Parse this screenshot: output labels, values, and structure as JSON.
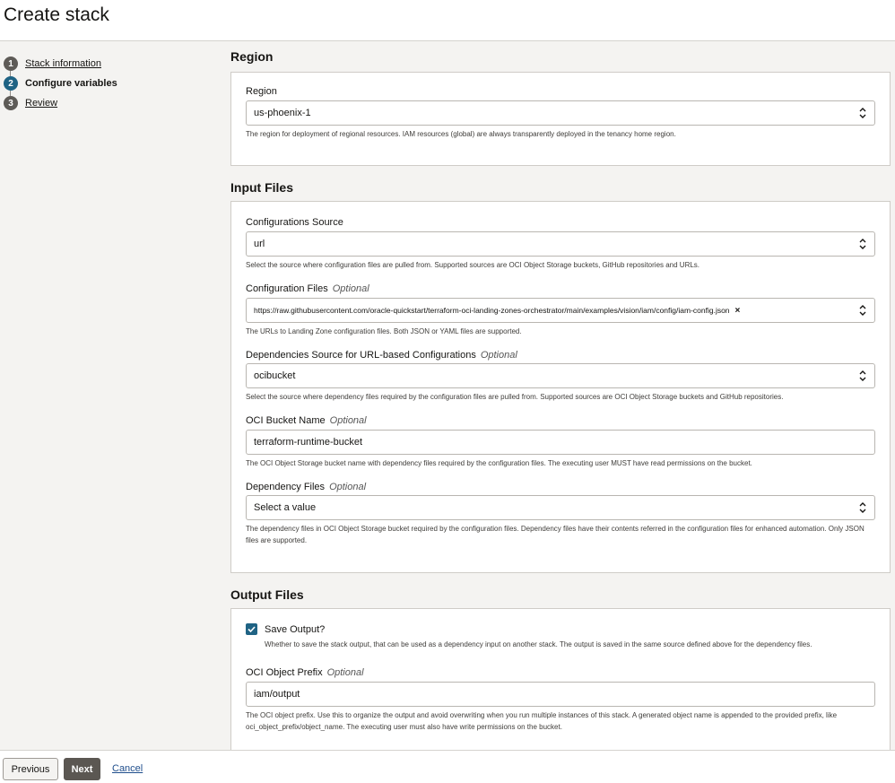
{
  "page": {
    "title": "Create stack"
  },
  "steps": [
    {
      "num": "1",
      "label": "Stack information"
    },
    {
      "num": "2",
      "label": "Configure variables"
    },
    {
      "num": "3",
      "label": "Review"
    }
  ],
  "region_section": {
    "title": "Region",
    "region_label": "Region",
    "region_value": "us-phoenix-1",
    "region_hint": "The region for deployment of regional resources. IAM resources (global) are always transparently deployed in the tenancy home region."
  },
  "input_section": {
    "title": "Input Files",
    "config_source_label": "Configurations Source",
    "config_source_value": "url",
    "config_source_hint": "Select the source where configuration files are pulled from. Supported sources are OCI Object Storage buckets, GitHub repositories and URLs.",
    "config_files_label": "Configuration Files",
    "optional": "Optional",
    "config_files_value": "https://raw.githubusercontent.com/oracle-quickstart/terraform-oci-landing-zones-orchestrator/main/examples/vision/iam/config/iam-config.json",
    "config_files_hint": "The URLs to Landing Zone configuration files. Both JSON or YAML files are supported.",
    "dep_source_label": "Dependencies Source for URL-based Configurations",
    "dep_source_value": "ocibucket",
    "dep_source_hint": "Select the source where dependency files required by the configuration files are pulled from. Supported sources are OCI Object Storage buckets and GitHub repositories.",
    "bucket_label": "OCI Bucket Name",
    "bucket_value": "terraform-runtime-bucket",
    "bucket_hint": "The OCI Object Storage bucket name with dependency files required by the configuration files. The executing user MUST have read permissions on the bucket.",
    "dep_files_label": "Dependency Files",
    "dep_files_placeholder": "Select a value",
    "dep_files_hint": "The dependency files in OCI Object Storage bucket required by the configuration files. Dependency files have their contents referred in the configuration files for enhanced automation. Only JSON files are supported."
  },
  "output_section": {
    "title": "Output Files",
    "save_label": "Save Output?",
    "save_checked": true,
    "save_hint": "Whether to save the stack output, that can be used as a dependency input on another stack. The output is saved in the same source defined above for the dependency files.",
    "prefix_label": "OCI Object Prefix",
    "prefix_value": "iam/output",
    "prefix_hint": "The OCI object prefix. Use this to organize the output and avoid overwriting when you run multiple instances of this stack. A generated object name is appended to the provided prefix, like oci_object_prefix/object_name. The executing user must also have write permissions on the bucket."
  },
  "footer": {
    "previous_label": "Previous",
    "next_label": "Next",
    "cancel_label": "Cancel"
  },
  "colors": {
    "accent": "#1f6384",
    "primary_button": "#5b5752",
    "link": "#1f4e8c"
  }
}
